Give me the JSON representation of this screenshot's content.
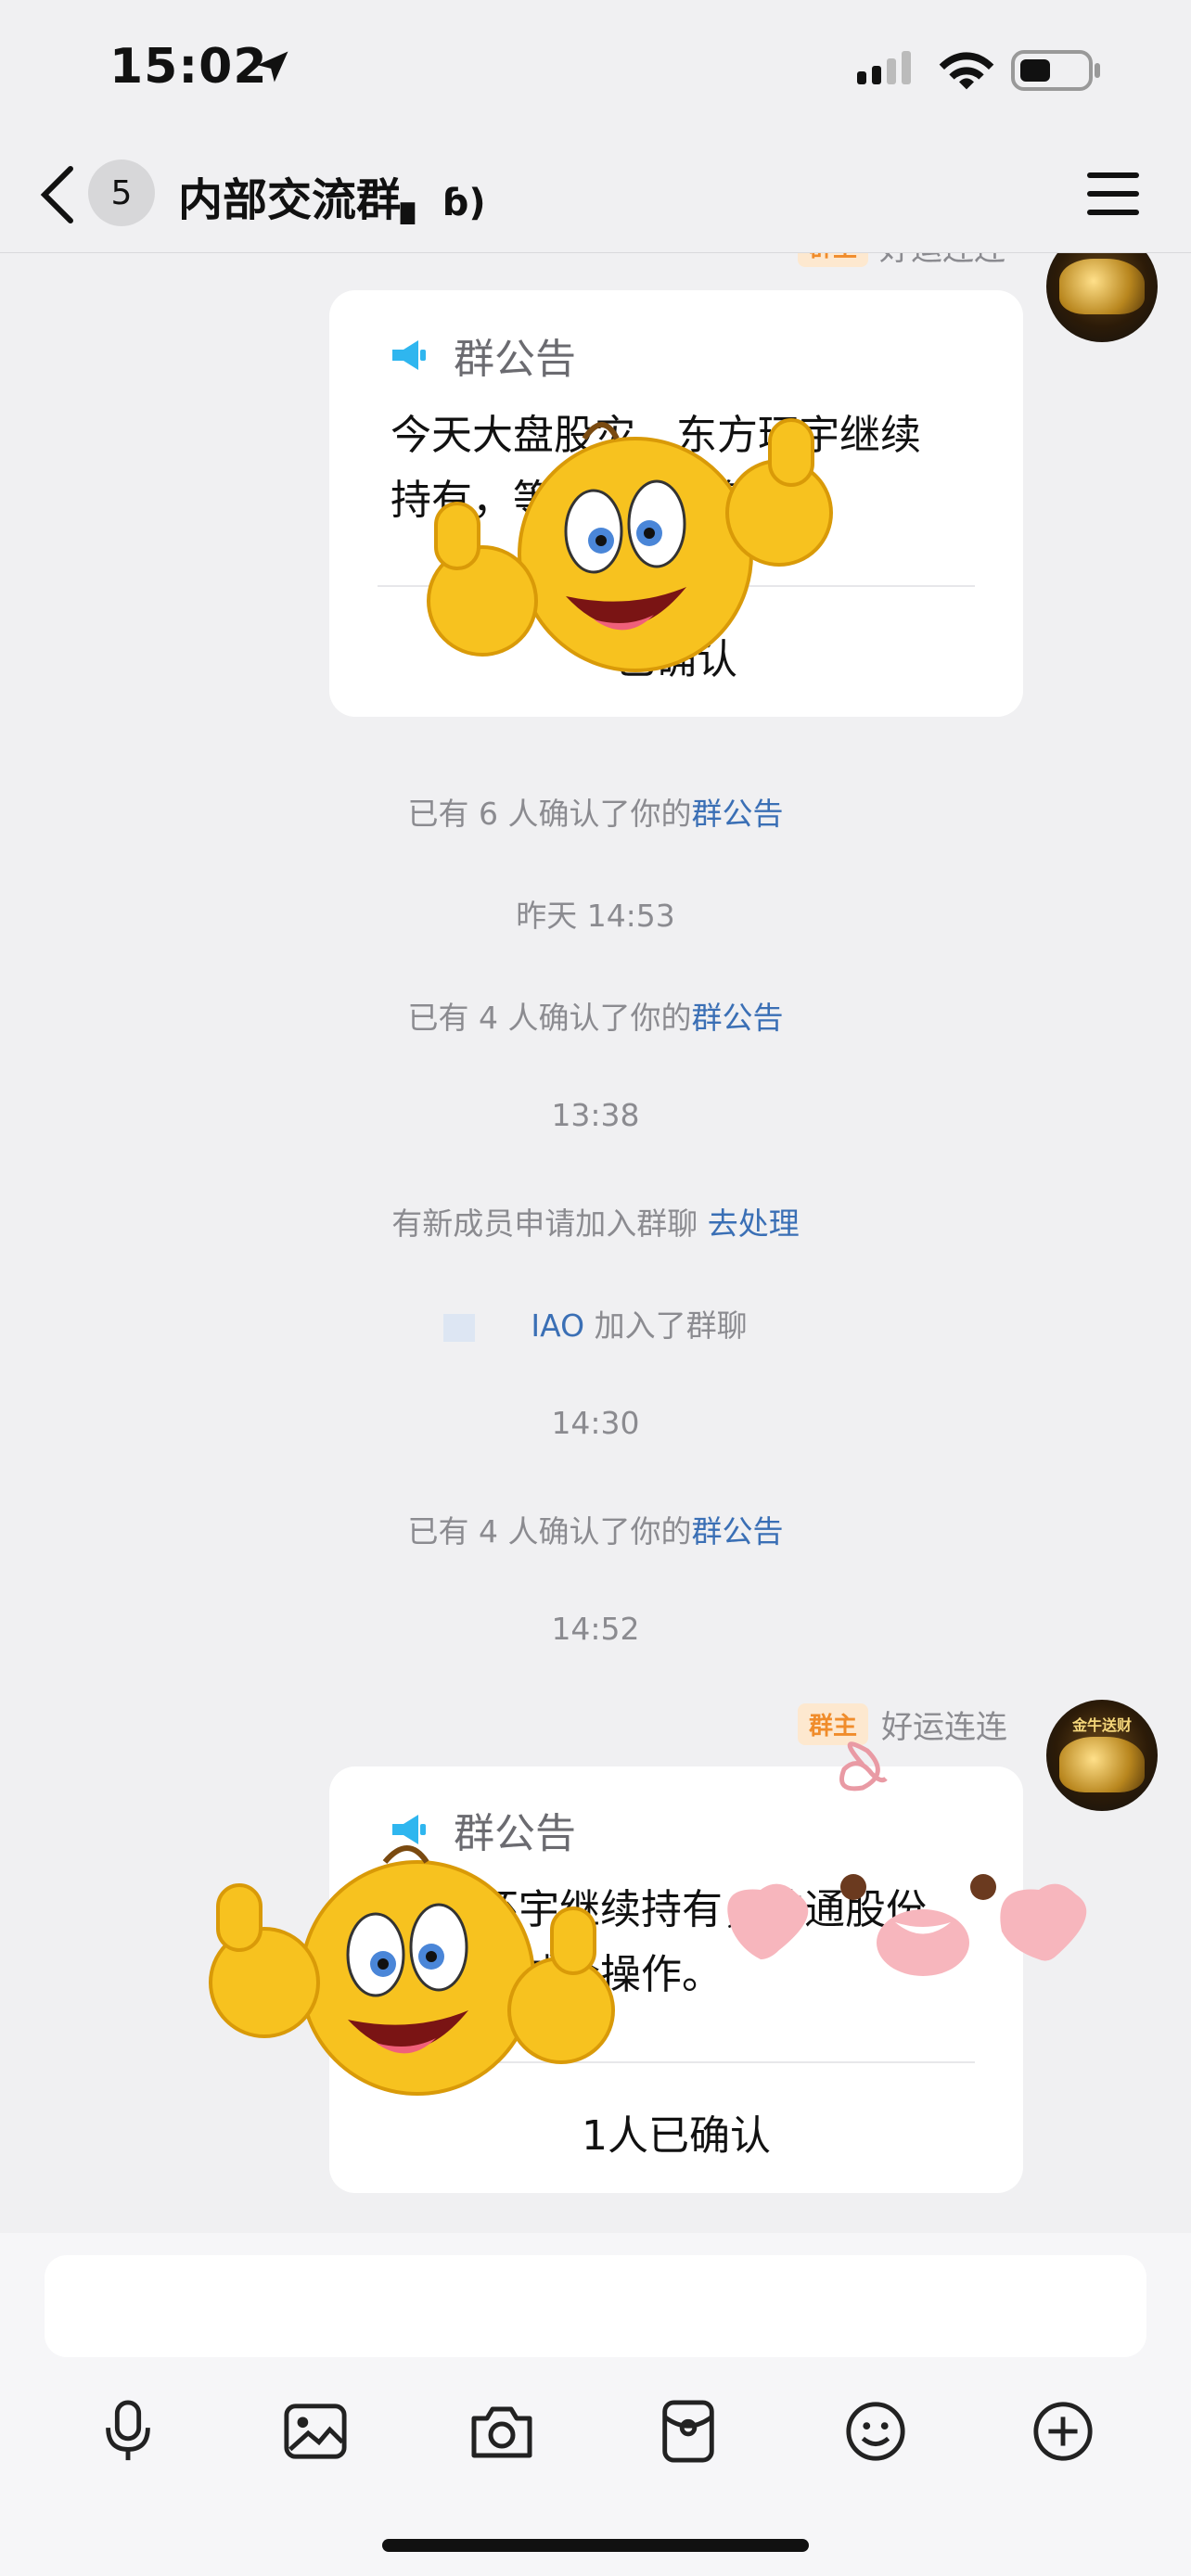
{
  "status_bar": {
    "time": "15:02"
  },
  "nav": {
    "back_count": "5",
    "title": "内部交流群",
    "title_suffix": "▖ ɓ)"
  },
  "top_partial": {
    "sender": "好运连连",
    "owner_tag": "群主"
  },
  "card1": {
    "header": "群公告",
    "line1": "今天大盘股灾，东方环宇继续",
    "line2": "持有，等待开板修复。",
    "confirm": "已确认"
  },
  "system": [
    {
      "pre": "已有 6 人确认了你的",
      "link": "群公告"
    },
    {
      "text": "昨天 14:53"
    },
    {
      "pre": "已有 4 人确认了你的",
      "link": "群公告"
    },
    {
      "text": "13:38"
    },
    {
      "pre": "有新成员申请加入群聊 ",
      "link": "去处理"
    },
    {
      "name": "IAO",
      "post": " 加入了群聊"
    },
    {
      "text": "14:30"
    },
    {
      "pre": "已有 4 人确认了你的",
      "link": "群公告"
    },
    {
      "text": "14:52"
    }
  ],
  "msg2": {
    "owner_tag": "群主",
    "sender": "好运连连",
    "avatar_text": "金牛送财"
  },
  "card2": {
    "header": "群公告",
    "line1": "环宇继续持有，铂通股份",
    "line2": "做减仓操作。",
    "confirm": "1人已确认"
  },
  "colors": {
    "accent_link": "#3a6fb5",
    "owner_tag_bg": "#fde8cf",
    "owner_tag_fg": "#f08c2b"
  },
  "icons": [
    "location-arrow-icon",
    "signal-icon",
    "wifi-icon",
    "battery-icon",
    "back-chevron-icon",
    "menu-icon",
    "megaphone-icon",
    "microphone-icon",
    "image-icon",
    "camera-icon",
    "red-packet-icon",
    "emoji-icon",
    "plus-icon"
  ]
}
